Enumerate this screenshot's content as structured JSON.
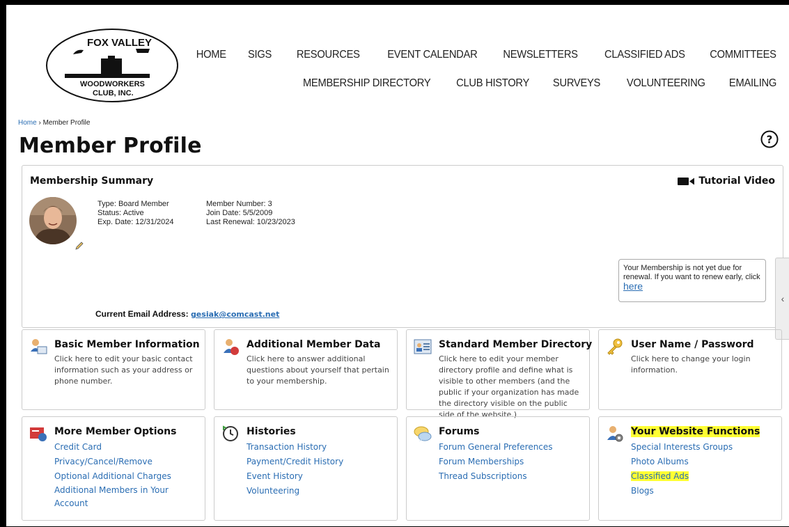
{
  "logo": {
    "line1": "FOX VALLEY",
    "line2": "WOODWORKERS",
    "line3": "CLUB, INC."
  },
  "nav": {
    "row1": [
      "HOME",
      "SIGS",
      "RESOURCES",
      "EVENT CALENDAR",
      "NEWSLETTERS",
      "CLASSIFIED ADS",
      "COMMITTEES"
    ],
    "row2": [
      "MEMBERSHIP DIRECTORY",
      "CLUB HISTORY",
      "SURVEYS",
      "VOLUNTEERING",
      "EMAILING"
    ]
  },
  "breadcrumb": {
    "home": "Home",
    "sep": "›",
    "current": "Member Profile"
  },
  "page_title": "Member Profile",
  "summary": {
    "title": "Membership Summary",
    "tutorial": "Tutorial Video",
    "type": "Type: Board Member",
    "status": "Status: Active",
    "exp": "Exp. Date: 12/31/2024",
    "member_number": "Member Number: 3",
    "join_date": "Join Date: 5/5/2009",
    "last_renewal": "Last Renewal: 10/23/2023",
    "renew_note": "Your Membership is not yet due for renewal. If you want to renew early, click",
    "renew_link": "here",
    "email_label": "Current Email Address:",
    "email": "gesiak@comcast.net"
  },
  "cards": {
    "basic": {
      "title": "Basic Member Information",
      "desc": "Click here to edit your basic contact information such as your address or phone number."
    },
    "additional": {
      "title": "Additional Member Data",
      "desc": "Click here to answer additional questions about yourself that pertain to your membership."
    },
    "directory": {
      "title": "Standard Member Directory",
      "desc": "Click here to edit your member directory profile and define what is visible to other members (and the public if your organization has made the directory visible on the public side of the website.)"
    },
    "password": {
      "title": "User Name / Password",
      "desc": "Click here to change your login information."
    },
    "options": {
      "title": "More Member Options",
      "links": [
        "Credit Card",
        "Privacy/Cancel/Remove",
        "Optional Additional Charges",
        "Additional Members in Your",
        "Account"
      ]
    },
    "histories": {
      "title": "Histories",
      "links": [
        "Transaction History",
        "Payment/Credit History",
        "Event History",
        "Volunteering"
      ]
    },
    "forums": {
      "title": "Forums",
      "links": [
        "Forum General Preferences",
        "Forum Memberships",
        "Thread Subscriptions"
      ]
    },
    "functions": {
      "title": "Your Website Functions",
      "links": [
        "Special Interests Groups",
        "Photo Albums",
        "Classified Ads",
        "Blogs"
      ]
    }
  },
  "colors": {
    "link": "#2a6db3",
    "highlight": "#ffff33"
  }
}
